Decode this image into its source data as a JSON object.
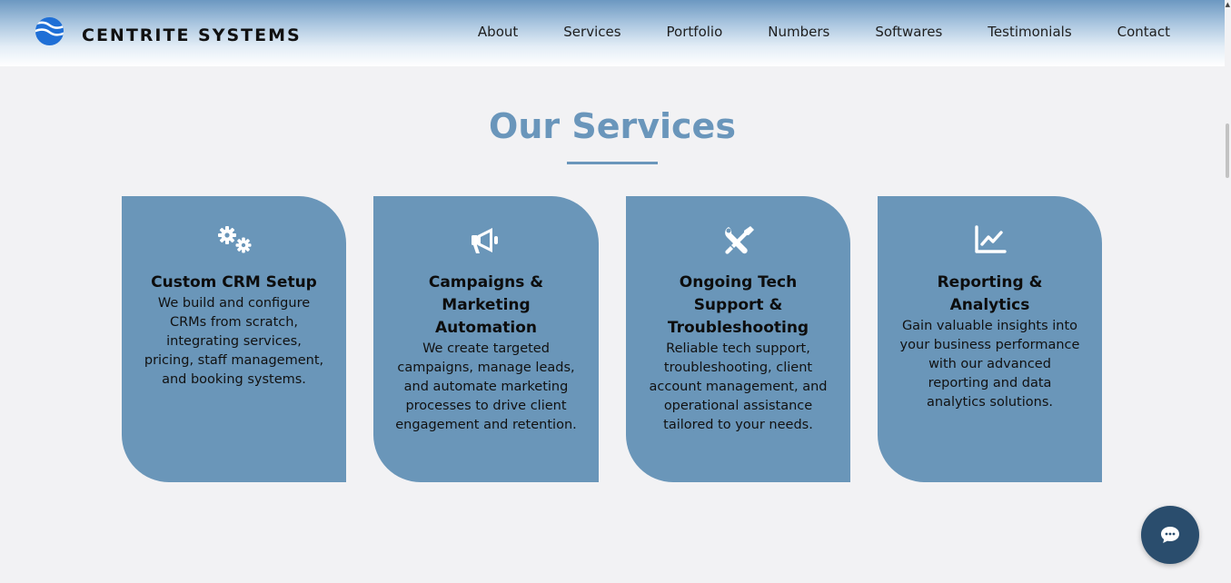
{
  "brand": {
    "name": "CENTRITE SYSTEMS",
    "logo_icon": "wave-globe-icon"
  },
  "nav": {
    "items": [
      {
        "label": "About"
      },
      {
        "label": "Services"
      },
      {
        "label": "Portfolio"
      },
      {
        "label": "Numbers"
      },
      {
        "label": "Softwares"
      },
      {
        "label": "Testimonials"
      },
      {
        "label": "Contact"
      }
    ]
  },
  "services": {
    "title": "Our Services",
    "cards": [
      {
        "icon": "gears-icon",
        "title": "Custom CRM Setup",
        "text": "We build and configure CRMs from scratch, integrating services, pricing, staff management, and booking systems."
      },
      {
        "icon": "megaphone-icon",
        "title": "Campaigns & Marketing Automation",
        "text": "We create targeted campaigns, manage leads, and automate marketing processes to drive client engagement and retention."
      },
      {
        "icon": "tools-icon",
        "title": "Ongoing Tech Support & Troubleshooting",
        "text": "Reliable tech support, troubleshooting, client account management, and operational assistance tailored to your needs."
      },
      {
        "icon": "line-chart-icon",
        "title": "Reporting & Analytics",
        "text": "Gain valuable insights into your business performance with our advanced reporting and data analytics solutions."
      }
    ]
  },
  "chat": {
    "icon": "chat-bubble-icon"
  },
  "colors": {
    "accent": "#6a96bb",
    "card_background": "#6a96b9",
    "chat_button": "#2a4d6d",
    "page_background": "#f2f2f4"
  }
}
